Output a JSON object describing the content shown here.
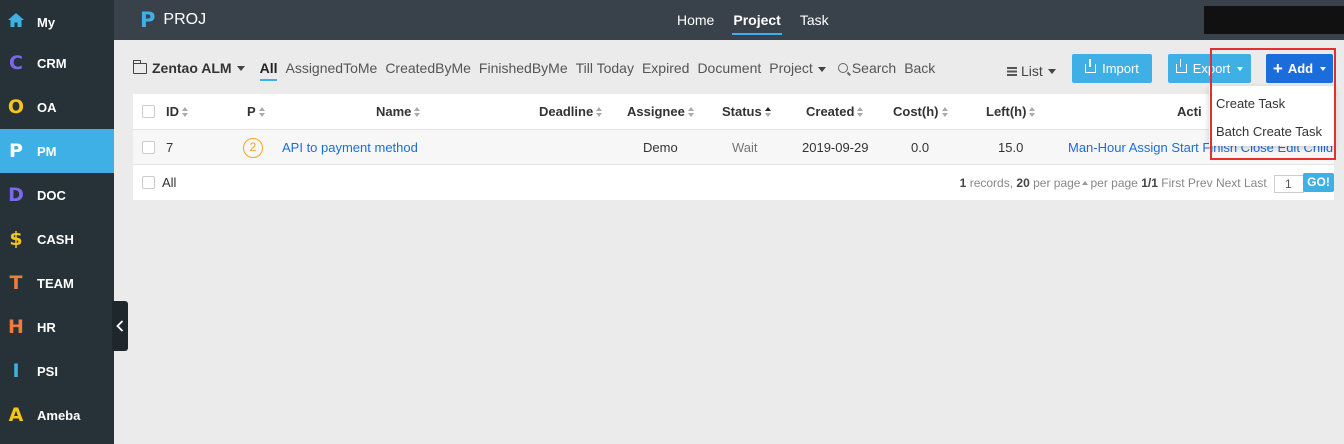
{
  "sidebar": {
    "items": [
      {
        "letter": "",
        "label": "My",
        "color": "#3fb0e6",
        "icon": "home-icon"
      },
      {
        "letter": "C",
        "label": "CRM",
        "color": "#7b68ee"
      },
      {
        "letter": "O",
        "label": "OA",
        "color": "#f5c518"
      },
      {
        "letter": "P",
        "label": "PM",
        "color": "#ffffff",
        "active": true
      },
      {
        "letter": "D",
        "label": "DOC",
        "color": "#7b68ee"
      },
      {
        "letter": "$",
        "label": "CASH",
        "color": "#f5c518"
      },
      {
        "letter": "T",
        "label": "TEAM",
        "color": "#f07b3f"
      },
      {
        "letter": "H",
        "label": "HR",
        "color": "#f07b3f"
      },
      {
        "letter": "I",
        "label": "PSI",
        "color": "#3fb0e6"
      },
      {
        "letter": "A",
        "label": "Ameba",
        "color": "#f5c518"
      }
    ]
  },
  "header": {
    "brand_letter": "P",
    "brand_title": "PROJ",
    "nav": [
      "Home",
      "Project",
      "Task"
    ],
    "active_nav": "Project"
  },
  "toolbar": {
    "project_name": "Zentao ALM",
    "tabs": [
      "All",
      "AssignedToMe",
      "CreatedByMe",
      "FinishedByMe",
      "Till Today",
      "Expired",
      "Document"
    ],
    "project_menu": "Project",
    "search_label": "Search",
    "back_label": "Back",
    "view_label": "List",
    "import_label": "Import",
    "export_label": "Export",
    "add_label": "Add"
  },
  "table": {
    "headers": {
      "id": "ID",
      "pri": "P",
      "name": "Name",
      "deadline": "Deadline",
      "assignee": "Assignee",
      "status": "Status",
      "created": "Created",
      "cost": "Cost(h)",
      "left": "Left(h)",
      "actions": "Acti"
    },
    "rows": [
      {
        "id": "7",
        "pri": "2",
        "name": "API to payment method",
        "deadline": "",
        "assignee": "Demo",
        "status": "Wait",
        "created": "2019-09-29",
        "cost": "0.0",
        "left": "15.0",
        "actions": "Man-Hour Assign Start Finish Close Edit Child"
      }
    ],
    "select_all_label": "All"
  },
  "pager": {
    "records": "1",
    "records_label": "records,",
    "per_page": "20",
    "per_page_label": "per page",
    "per_page_label2": "per page",
    "page": "1/1",
    "first": "First",
    "prev": "Prev",
    "next": "Next",
    "last": "Last",
    "input": "1",
    "go": "GO!"
  },
  "add_menu": {
    "items": [
      "Create Task",
      "Batch Create Task"
    ]
  }
}
